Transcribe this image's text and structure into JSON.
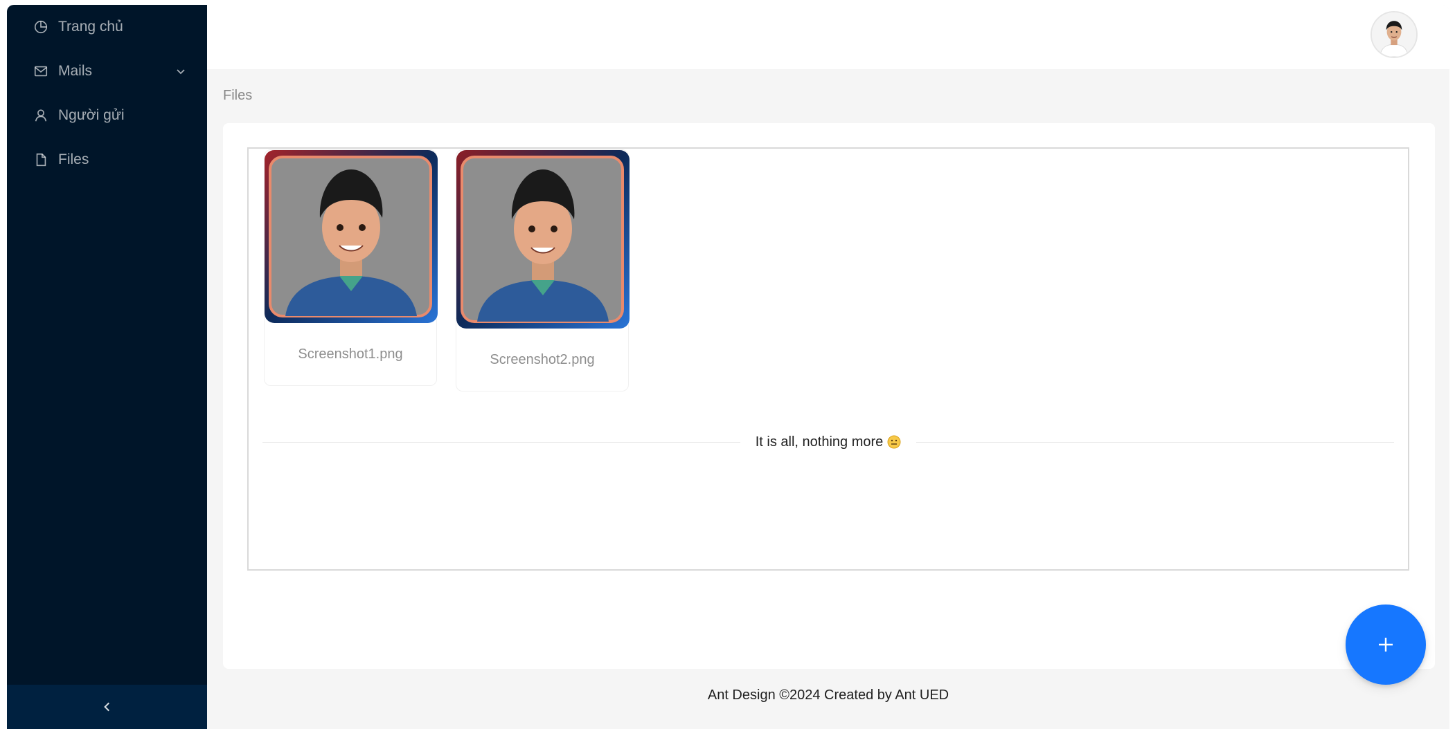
{
  "sidebar": {
    "items": [
      {
        "label": "Trang chủ",
        "icon": "pie-chart-icon"
      },
      {
        "label": "Mails",
        "icon": "mail-icon",
        "has_submenu": true
      },
      {
        "label": "Người gửi",
        "icon": "user-icon"
      },
      {
        "label": "Files",
        "icon": "file-icon"
      }
    ],
    "collapse_icon": "chevron-left-icon"
  },
  "header": {
    "avatar_icon": "user-avatar"
  },
  "breadcrumb": {
    "current": "Files"
  },
  "files": [
    {
      "name": "Screenshot1.png"
    },
    {
      "name": "Screenshot2.png"
    }
  ],
  "divider": {
    "text": "It is all, nothing more",
    "emoji_icon": "face-emoji-icon"
  },
  "fab": {
    "icon": "plus-icon"
  },
  "footer": {
    "text": "Ant Design ©2024 Created by Ant UED"
  },
  "colors": {
    "sidebar_bg": "#001529",
    "primary": "#1677ff",
    "page_bg": "#f5f5f5"
  }
}
